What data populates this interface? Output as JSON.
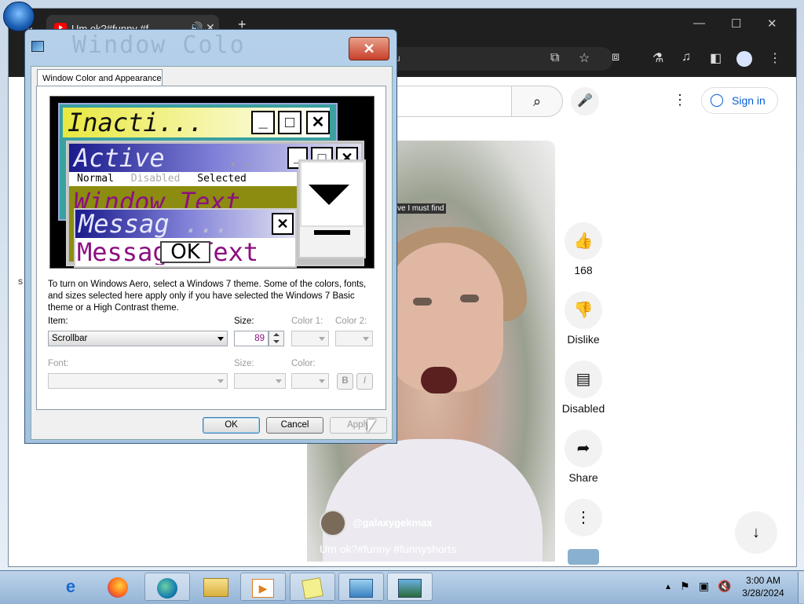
{
  "browser": {
    "tab_title": "Um ok?#funny #f",
    "new_tab": "+",
    "omnibox_text": "u"
  },
  "youtube": {
    "sign_in": "Sign in",
    "overlay_text": "ve I must find",
    "like_count": "168",
    "dislike_label": "Dislike",
    "comments_label": "Disabled",
    "share_label": "Share",
    "channel": "@galaxygekmax",
    "video_title": "Um ok?#funny #funnyshorts",
    "left_edge_char": "s"
  },
  "dialog": {
    "title_ghost": "Window Colo",
    "tab_label": "Window Color and Appearance",
    "preview": {
      "inactive": "Inacti...",
      "active": "Active",
      "active_dots": "..",
      "menu_normal": "Normal",
      "menu_disabled": "Disabled",
      "menu_selected": "Selected",
      "window_text": "Window Text",
      "message": "Messag",
      "message_dots": "...",
      "message_text": "Message Text",
      "ok": "OK",
      "btn_min": "_",
      "btn_max": "□",
      "btn_close": "✕"
    },
    "description": "To turn on Windows Aero, select a Windows 7 theme.  Some of the colors, fonts, and sizes selected here apply only if you have selected the Windows 7 Basic theme or a High Contrast theme.",
    "item_label": "Item:",
    "item_value": "Scrollbar",
    "size_label": "Size:",
    "size_value": "89",
    "color1_label": "Color 1:",
    "color2_label": "Color 2:",
    "font_label": "Font:",
    "font_size_label": "Size:",
    "font_color_label": "Color:",
    "bold": "B",
    "italic": "I",
    "ok": "OK",
    "cancel": "Cancel",
    "apply": "Apply"
  },
  "taskbar": {
    "time": "3:00 AM",
    "date": "3/28/2024"
  },
  "colors": {
    "inactive_title": "#e8e840",
    "active_title": "#1a1a8c",
    "window_bg": "#8c8c10",
    "window_text": "#8c1080",
    "youtube_red": "#ff0000"
  }
}
